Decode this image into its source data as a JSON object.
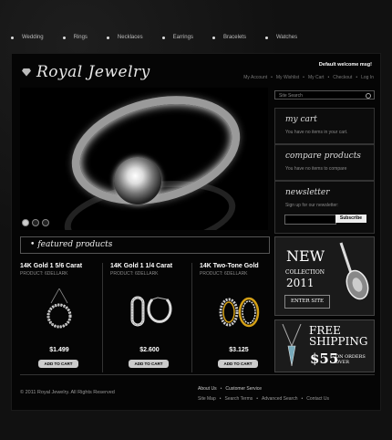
{
  "nav": {
    "items": [
      "Wedding",
      "Rings",
      "Necklaces",
      "Earrings",
      "Bracelets",
      "Watches"
    ]
  },
  "logo": {
    "text": "Royal Jewelry"
  },
  "header": {
    "welcome": "Default welcome msg!",
    "links": [
      "My Account",
      "My Wishlist",
      "My Cart",
      "Checkout",
      "Log In"
    ]
  },
  "search": {
    "placeholder": "Site Search"
  },
  "cart": {
    "title": "my cart",
    "text": "You have no items in your cart."
  },
  "compare": {
    "title": "compare products",
    "text": "You have no items to compare"
  },
  "newsletter": {
    "title": "newsletter",
    "text": "Sign up for our newsletter:",
    "button": "Subscribe"
  },
  "featured": {
    "title": "featured products"
  },
  "products": [
    {
      "name": "14K Gold 1 5/6 Carat",
      "code": "PRODUCT: 6DELLARK",
      "price": "$1.499",
      "button": "ADD TO CART"
    },
    {
      "name": "14K Gold 1 1/4 Carat",
      "code": "PRODUCT: 6DELLARK",
      "price": "$2.600",
      "button": "ADD TO CART"
    },
    {
      "name": "14K Two-Tone Gold",
      "code": "PRODUCT: 6DELLARK",
      "price": "$3.125",
      "button": "ADD TO CART"
    }
  ],
  "promo1": {
    "new": "NEW",
    "collection": "COLLECTION",
    "year": "2011",
    "button": "ENTER SITE"
  },
  "promo2": {
    "free": "FREE",
    "shipping": "SHIPPING",
    "amount": "$55",
    "orders": "ON ORDERS",
    "over": "OVER"
  },
  "footer": {
    "copyright": "© 2011 Royal Jewelry. All Rights Reserved",
    "links_row1": [
      "About Us",
      "Customer Service"
    ],
    "links_row2": [
      "Site Map",
      "Search Terms",
      "Advanced Search",
      "Contact Us"
    ]
  },
  "colors": {
    "background": "#111111",
    "text": "#cccccc",
    "accent": "#ffffff"
  }
}
